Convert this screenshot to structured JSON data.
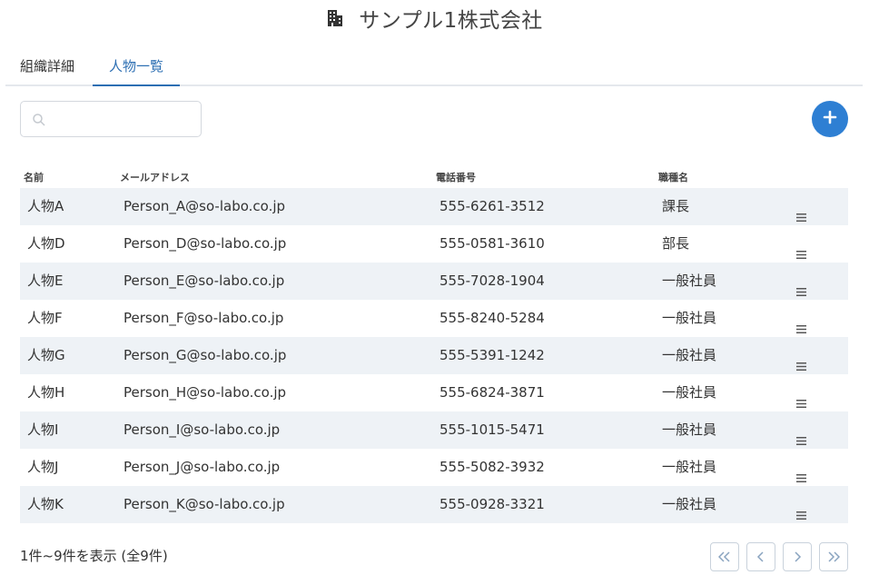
{
  "title": {
    "icon": "building-icon",
    "text": "サンプル1株式会社"
  },
  "tabs": [
    {
      "label": "組織詳細",
      "active": false
    },
    {
      "label": "人物一覧",
      "active": true
    }
  ],
  "search": {
    "placeholder": "",
    "value": "",
    "icon": "search-icon"
  },
  "add_button": {
    "icon": "plus-icon",
    "color": "#2e7fd3"
  },
  "table": {
    "headers": {
      "name": "名前",
      "email": "メールアドレス",
      "phone": "電話番号",
      "role": "職種名"
    },
    "rows": [
      {
        "name": "人物A",
        "email": "Person_A@so-labo.co.jp",
        "phone": "555-6261-3512",
        "role": "課長"
      },
      {
        "name": "人物D",
        "email": "Person_D@so-labo.co.jp",
        "phone": "555-0581-3610",
        "role": "部長"
      },
      {
        "name": "人物E",
        "email": "Person_E@so-labo.co.jp",
        "phone": "555-7028-1904",
        "role": "一般社員"
      },
      {
        "name": "人物F",
        "email": "Person_F@so-labo.co.jp",
        "phone": "555-8240-5284",
        "role": "一般社員"
      },
      {
        "name": "人物G",
        "email": "Person_G@so-labo.co.jp",
        "phone": "555-5391-1242",
        "role": "一般社員"
      },
      {
        "name": "人物H",
        "email": "Person_H@so-labo.co.jp",
        "phone": "555-6824-3871",
        "role": "一般社員"
      },
      {
        "name": "人物I",
        "email": "Person_I@so-labo.co.jp",
        "phone": "555-1015-5471",
        "role": "一般社員"
      },
      {
        "name": "人物J",
        "email": "Person_J@so-labo.co.jp",
        "phone": "555-5082-3932",
        "role": "一般社員"
      },
      {
        "name": "人物K",
        "email": "Person_K@so-labo.co.jp",
        "phone": "555-0928-3321",
        "role": "一般社員"
      }
    ]
  },
  "footer": {
    "summary": "1件~9件を表示 (全9件)"
  },
  "pagination": {
    "buttons": [
      "first-page-icon",
      "prev-page-icon",
      "next-page-icon",
      "last-page-icon"
    ]
  },
  "colors": {
    "accent": "#2d6fb3",
    "add_button": "#2e7fd3",
    "row_stripe": "#eef2f6"
  }
}
